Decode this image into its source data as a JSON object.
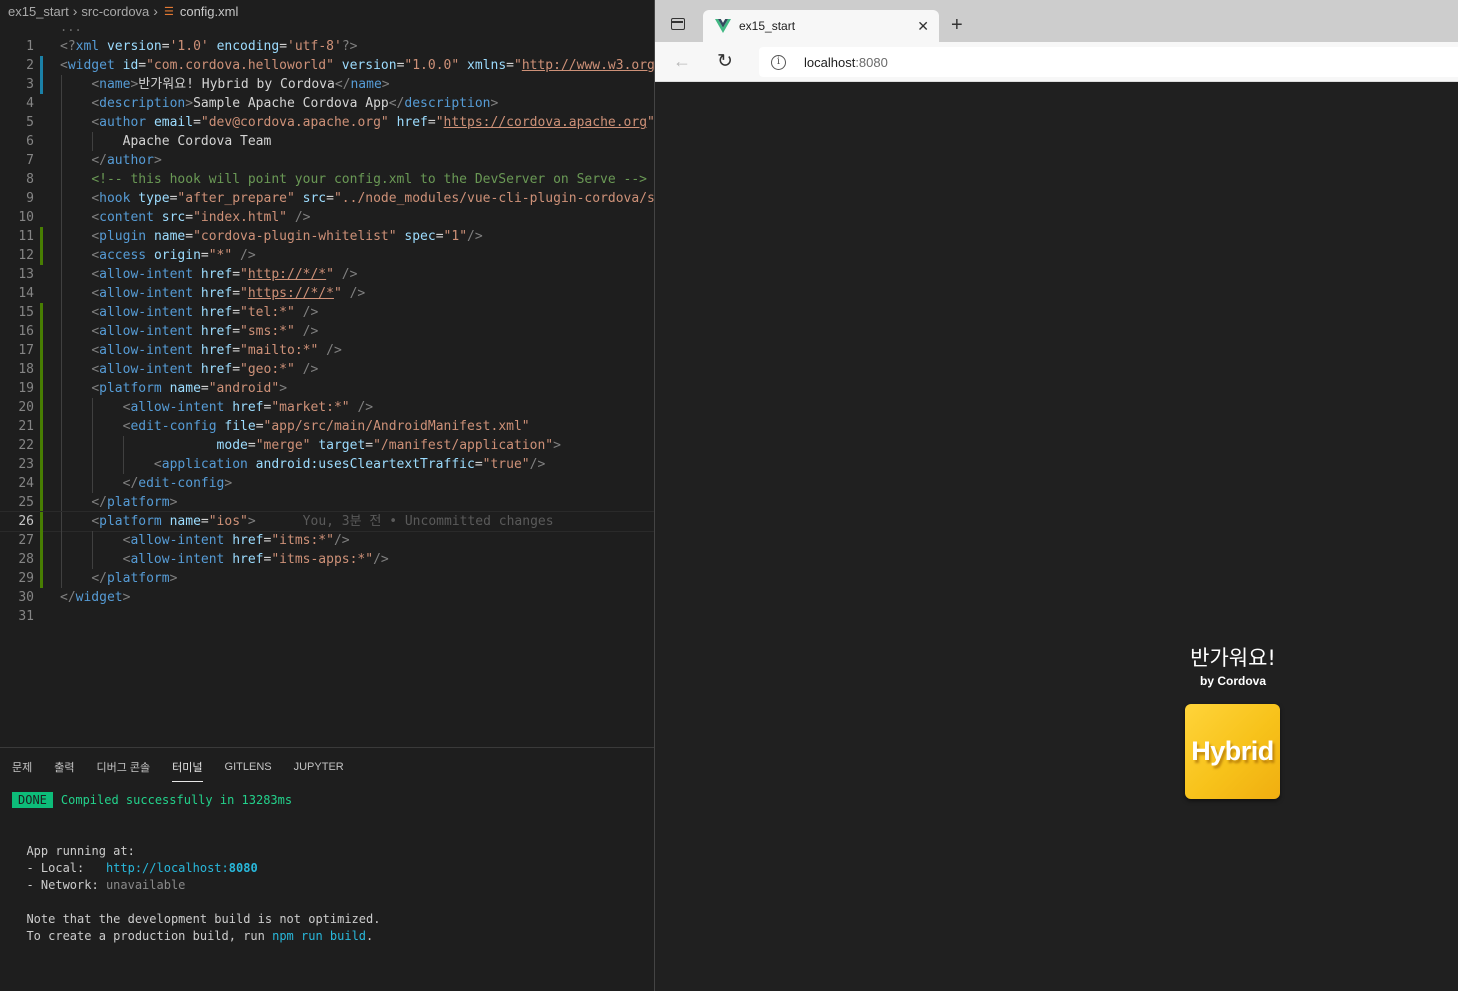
{
  "breadcrumb": {
    "folder1": "ex15_start",
    "folder2": "src-cordova",
    "file": "config.xml"
  },
  "editor": {
    "ellipsis": "...",
    "line_numbers": [
      "1",
      "2",
      "3",
      "4",
      "5",
      "6",
      "7",
      "8",
      "9",
      "10",
      "11",
      "12",
      "13",
      "14",
      "15",
      "16",
      "17",
      "18",
      "19",
      "20",
      "21",
      "22",
      "23",
      "24",
      "25",
      "26",
      "27",
      "28",
      "29",
      "30",
      "31"
    ],
    "current_line": "26",
    "blame": "You, 3분 전 • Uncommitted changes"
  },
  "panel": {
    "tabs": [
      "문제",
      "출력",
      "디버그 콘솔",
      "터미널",
      "GITLENS",
      "JUPYTER"
    ],
    "active_tab": "터미널",
    "terminal": {
      "done_badge": "DONE",
      "compiled": "Compiled successfully in 13283ms",
      "running": "App running at:",
      "local_label": "- Local:   ",
      "local_url": "http://localhost:",
      "local_port": "8080",
      "network_label": "- Network: ",
      "network_value": "unavailable",
      "note1": "Note that the development build is not optimized.",
      "note2_prefix": "To create a production build, run ",
      "note2_cmd": "npm run build",
      "note2_suffix": "."
    }
  },
  "browser": {
    "tab_title": "ex15_start",
    "url_host": "localhost",
    "url_port": ":8080",
    "page": {
      "heading": "반가워요!",
      "subheading": "by Cordova",
      "logo_text": "Hybrid"
    }
  },
  "colors": {
    "editor_bg": "#1e1e1e",
    "tag": "#569cd6",
    "attribute": "#9cdcfe",
    "string": "#ce9178",
    "comment": "#6a9955",
    "done_badge": "#0dbc79",
    "logo_yellow": "#f7c21a"
  },
  "icons": [
    "rss-file-icon",
    "tab-list-icon",
    "vue-logo-icon",
    "close-icon",
    "plus-icon",
    "back-arrow-icon",
    "reload-icon",
    "info-icon"
  ]
}
